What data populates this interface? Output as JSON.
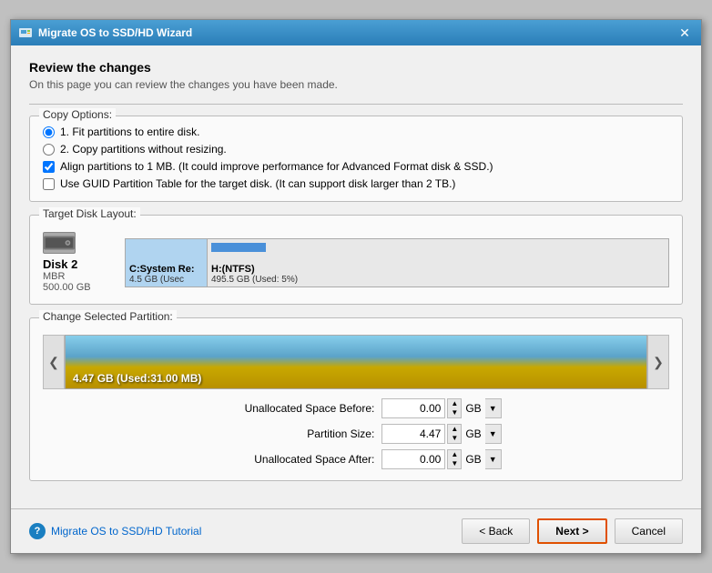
{
  "window": {
    "title": "Migrate OS to SSD/HD Wizard",
    "close_label": "✕"
  },
  "page": {
    "title": "Review the changes",
    "subtitle": "On this page you can review the changes you have been made."
  },
  "copy_options": {
    "section_label": "Copy Options:",
    "radio1": "1. Fit partitions to entire disk.",
    "radio2": "2. Copy partitions without resizing.",
    "checkbox1": "Align partitions to 1 MB.  (It could improve performance for Advanced Format disk & SSD.)",
    "checkbox2": "Use GUID Partition Table for the target disk. (It can support disk larger than 2 TB.)",
    "radio1_checked": true,
    "radio2_checked": false,
    "checkbox1_checked": true,
    "checkbox2_checked": false
  },
  "target_disk": {
    "section_label": "Target Disk Layout:",
    "disk_name": "Disk 2",
    "disk_type": "MBR",
    "disk_size": "500.00 GB",
    "partition_c_label": "C:System Re:",
    "partition_c_size": "4.5 GB (Usec",
    "partition_h_label": "H:(NTFS)",
    "partition_h_size": "495.5 GB (Used: 5%)"
  },
  "change_partition": {
    "section_label": "Change Selected Partition:",
    "partition_info": "4.47 GB (Used:31.00 MB)",
    "left_arrow": "❮",
    "right_arrow": "❯",
    "unallocated_before_label": "Unallocated Space Before:",
    "unallocated_before_value": "0.00",
    "unallocated_before_unit": "GB",
    "partition_size_label": "Partition Size:",
    "partition_size_value": "4.47",
    "partition_size_unit": "GB",
    "unallocated_after_label": "Unallocated Space After:",
    "unallocated_after_value": "0.00",
    "unallocated_after_unit": "GB"
  },
  "footer": {
    "help_icon": "?",
    "tutorial_link": "Migrate OS to SSD/HD Tutorial",
    "back_label": "< Back",
    "next_label": "Next >",
    "cancel_label": "Cancel"
  }
}
